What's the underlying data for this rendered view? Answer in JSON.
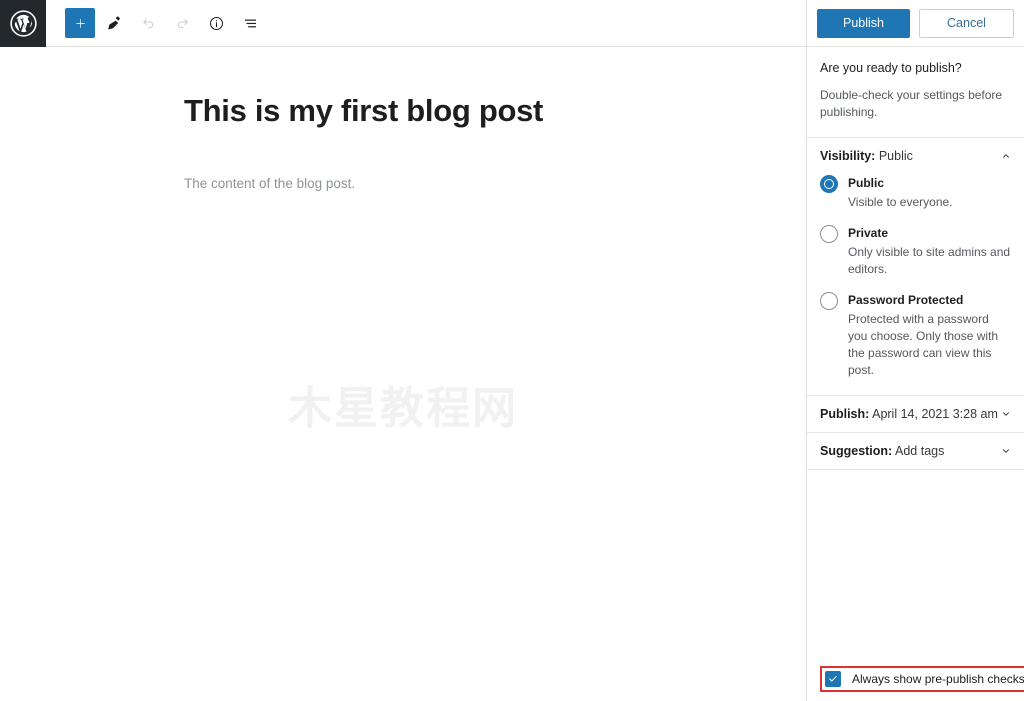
{
  "toolbar": {
    "logo_icon": "wordpress-logo-icon",
    "buttons": [
      {
        "name": "add-block-button",
        "icon": "plus-icon",
        "state": "active"
      },
      {
        "name": "tools-button",
        "icon": "pencil-icon",
        "state": "default"
      },
      {
        "name": "undo-button",
        "icon": "undo-arrow-icon",
        "state": "disabled"
      },
      {
        "name": "redo-button",
        "icon": "redo-arrow-icon",
        "state": "disabled"
      },
      {
        "name": "details-button",
        "icon": "info-circle-icon",
        "state": "default"
      },
      {
        "name": "list-view-button",
        "icon": "list-view-icon",
        "state": "default"
      }
    ]
  },
  "post": {
    "title": "This is my first blog post",
    "body": "The content of the blog post.",
    "watermark": "木星教程网"
  },
  "sidebar": {
    "publish_label": "Publish",
    "cancel_label": "Cancel",
    "intro_title": "Are you ready to publish?",
    "intro_sub": "Double-check your settings before publishing.",
    "visibility": {
      "label_key": "Visibility:",
      "label_value": "Public",
      "expanded": true,
      "chevron_icon": "chevron-up-icon",
      "options": [
        {
          "title": "Public",
          "desc": "Visible to everyone.",
          "selected": true
        },
        {
          "title": "Private",
          "desc": "Only visible to site admins and editors.",
          "selected": false
        },
        {
          "title": "Password Protected",
          "desc": "Protected with a password you choose. Only those with the password can view this post.",
          "selected": false
        }
      ]
    },
    "publish_date": {
      "label_key": "Publish:",
      "label_value": "April 14, 2021 3:28 am",
      "expanded": false,
      "chevron_icon": "chevron-down-icon"
    },
    "suggestion": {
      "label_key": "Suggestion:",
      "label_value": "Add tags",
      "expanded": false,
      "chevron_icon": "chevron-down-icon"
    },
    "prepublish_checkbox": {
      "label": "Always show pre-publish checks.",
      "checked": true,
      "highlight_color": "#e03030"
    }
  },
  "colors": {
    "accent_blue": "#1e76b4",
    "logo_bg": "#23282d",
    "border": "#e0e0e0",
    "muted_text": "#54595e",
    "body_text": "#8f9499",
    "highlight_red": "#e03030",
    "watermark": "#f1f1f1"
  }
}
